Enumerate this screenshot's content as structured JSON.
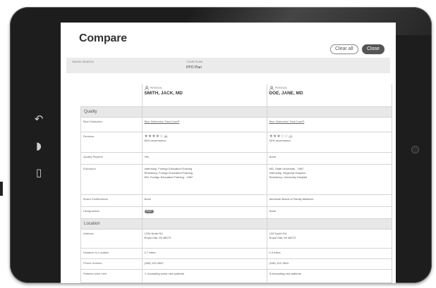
{
  "header": {
    "title": "Compare",
    "clear_all_label": "Clear all",
    "close_label": "Close"
  },
  "plan_bar": {
    "label_left": "SAVED SEARCH",
    "label_right": "YOUR PLAN",
    "plan_value": "PPO Plan"
  },
  "providers": [
    {
      "type": "PERSON",
      "name": "SMITH, JACK, MD"
    },
    {
      "type": "PERSON",
      "name": "DOE, JANE, MD"
    }
  ],
  "sections": {
    "quality": "Quality",
    "location": "Location"
  },
  "rows": {
    "blue_distinction": {
      "label": "Blue Distinction",
      "values": [
        "Blue Distinction Total Care®",
        "Blue Distinction Total Care®"
      ]
    },
    "reviews": {
      "label": "Reviews",
      "stars": [
        "★★★★☆",
        "★★★☆☆"
      ],
      "counts": [
        "(8)",
        "(2)"
      ],
      "recommend": [
        "80% recommend",
        "50% recommend"
      ]
    },
    "quality_reports": {
      "label": "Quality Reports",
      "values": [
        "Yes",
        "None"
      ]
    },
    "education": {
      "label": "Education",
      "values": [
        [
          "Internship, Foreign Education/Training",
          "Residency, Foreign Education/Training",
          "MD, Foreign Education/Training - 1987"
        ],
        [
          "MD, State University - 1987",
          "Internship, Regional Hospital",
          "Residency, University Hospital"
        ]
      ]
    },
    "board": {
      "label": "Board Certifications",
      "values": [
        "None",
        "American Board of Family Medicine"
      ]
    },
    "designations": {
      "label": "Designations",
      "badge": "PCP",
      "values": [
        "",
        "None"
      ]
    },
    "address": {
      "label": "Address",
      "lines": [
        [
          "1234 North Rd",
          "Royal Oak, MI 48073"
        ],
        [
          "123 South Rd.",
          "Royal Oak, MI 48073"
        ]
      ]
    },
    "distance": {
      "label": "Distance to Location",
      "values": [
        "0.7 miles",
        "0.4 miles"
      ]
    },
    "phone": {
      "label": "Phone Number",
      "values": [
        "(248) 123-4567",
        "(248) 123-7654"
      ]
    },
    "patients": {
      "label": "Patients seen here",
      "values": [
        "⚠ Accepting some new patients",
        "⊘ Accepting new patients"
      ]
    }
  }
}
